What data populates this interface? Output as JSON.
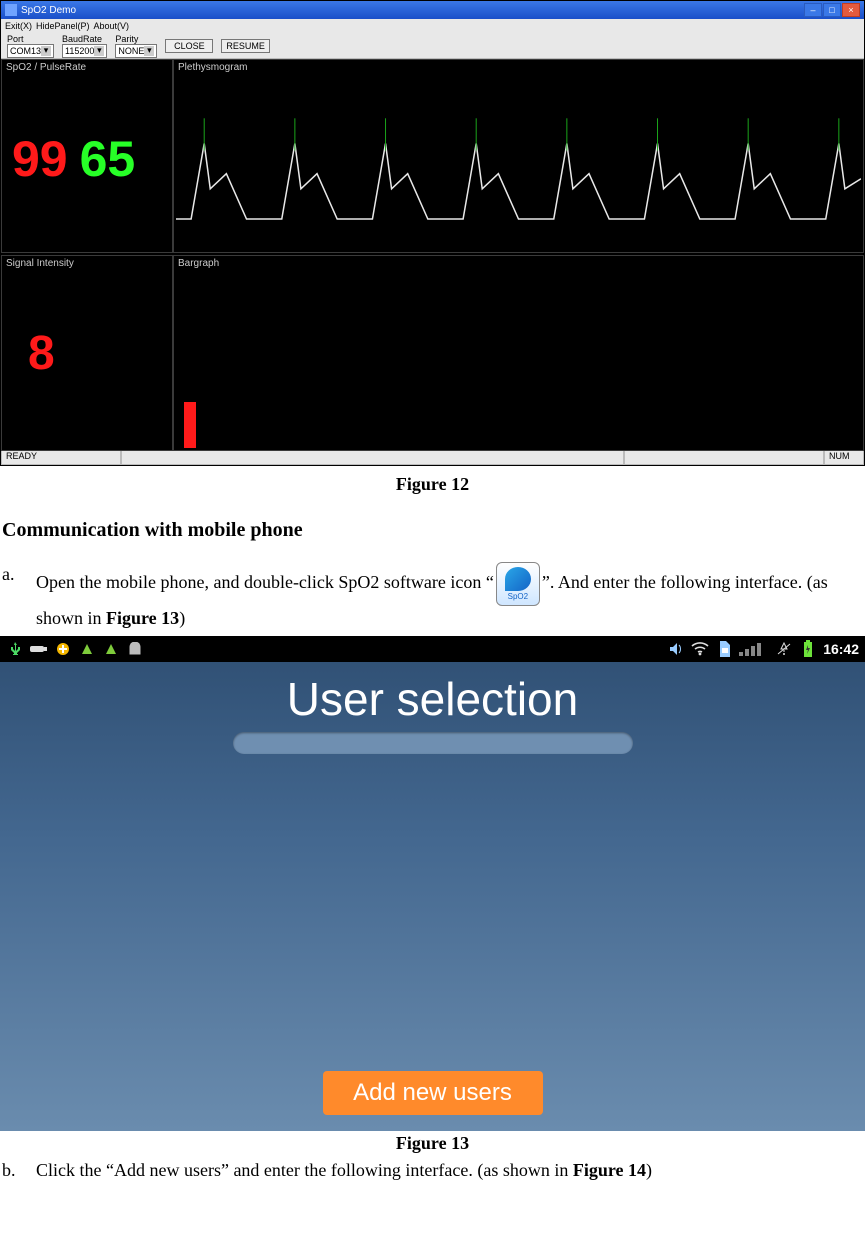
{
  "figure12": {
    "window_title": "SpO2 Demo",
    "menu": {
      "exit": "Exit(X)",
      "hidepanel": "HidePanel(P)",
      "about": "About(V)"
    },
    "toolbar": {
      "port_label": "Port",
      "port_value": "COM13",
      "baud_label": "BaudRate",
      "baud_value": "115200",
      "parity_label": "Parity",
      "parity_value": "NONE",
      "close_btn": "CLOSE",
      "resume_btn": "RESUME"
    },
    "panels": {
      "spo2_title": "SpO2 / PulseRate",
      "pleth_title": "Plethysmogram",
      "signal_title": "Signal Intensity",
      "bargraph_title": "Bargraph"
    },
    "readings": {
      "spo2": "99",
      "pulse": "65",
      "signal": "8"
    },
    "status": {
      "ready": "READY",
      "num": "NUM"
    }
  },
  "captions": {
    "fig12": "Figure 12",
    "fig13": "Figure 13"
  },
  "section_heading": "Communication with mobile phone",
  "steps": {
    "a_pre": "Open the mobile phone, and double-click SpO2 software icon “",
    "a_post": "”. And enter the following interface. (as shown in ",
    "a_fig": "Figure 13",
    "a_close": ")",
    "b_pre": "Click the “Add new users” and enter the following interface. (as shown in ",
    "b_fig": "Figure 14",
    "b_close": ")"
  },
  "figure13": {
    "status_time": "16:42",
    "title": "User selection",
    "add_button": "Add new users"
  }
}
